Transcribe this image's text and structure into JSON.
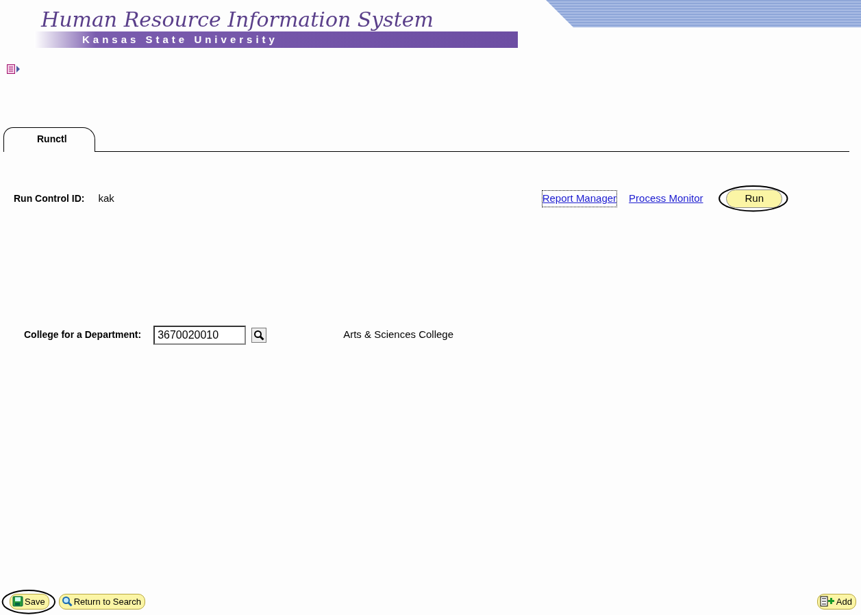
{
  "header": {
    "title": "Human Resource Information System",
    "subtitle": "Kansas State University"
  },
  "tabs": [
    {
      "label": "Runctl",
      "selected": true
    }
  ],
  "run_control": {
    "label": "Run Control ID:",
    "value": "kak"
  },
  "links": [
    {
      "label": "Report Manager",
      "focused": true
    },
    {
      "label": "Process Monitor",
      "focused": false
    }
  ],
  "run_button": {
    "label": "Run",
    "circled": true
  },
  "field": {
    "label": "College for a Department:",
    "value": "3670020010",
    "description": "Arts & Sciences College"
  },
  "toolbar": [
    {
      "kind": "save",
      "label": "Save",
      "circled": true
    },
    {
      "kind": "search",
      "label": "Return to Search",
      "circled": false
    },
    {
      "kind": "add",
      "label": "Add",
      "circled": false
    }
  ]
}
